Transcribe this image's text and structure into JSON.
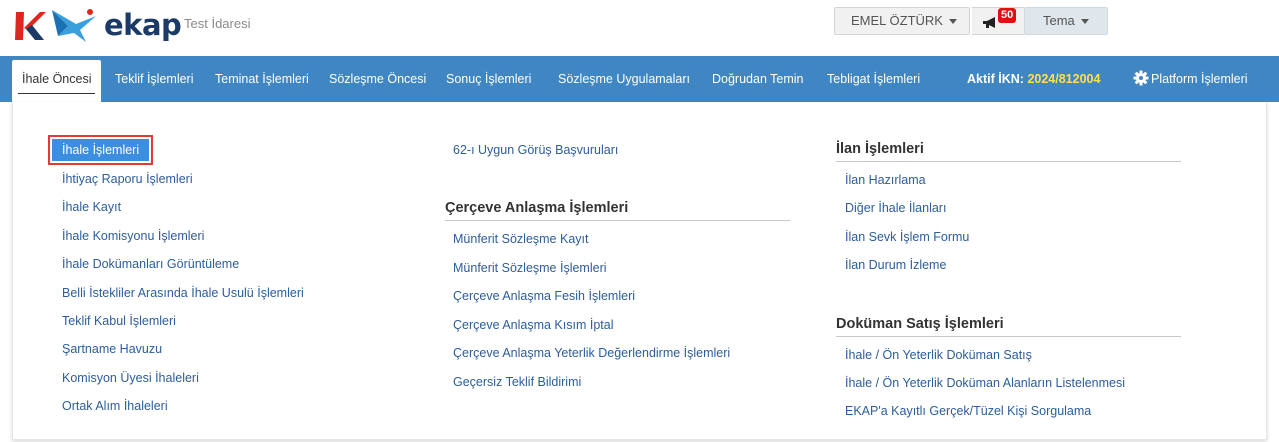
{
  "header": {
    "brand": "ekap",
    "org": "Test İdaresi",
    "user": "EMEL ÖZTÜRK",
    "notification_count": "50",
    "theme": "Tema",
    "colors": {
      "brand_red": "#e0261f",
      "brand_navy": "#1b3a66",
      "bird_blue": "#3aa0dc",
      "badge": "#e01010"
    }
  },
  "nav": {
    "items": [
      "İhale Öncesi",
      "Teklif İşlemleri",
      "Teminat İşlemleri",
      "Sözleşme Öncesi",
      "Sonuç İşlemleri",
      "Sözleşme Uygulamaları",
      "Doğrudan Temin",
      "Tebligat İşlemleri"
    ],
    "active_index": 0,
    "ikn_label": "Aktif İKN:",
    "ikn_value": "2024/812004",
    "platform": "Platform İşlemleri",
    "colors": {
      "bar": "#3f86c2",
      "ikn": "#ffe14a"
    }
  },
  "menu": {
    "col1": [
      "İhale İşlemleri",
      "İhtiyaç Raporu İşlemleri",
      "İhale Kayıt",
      "İhale Komisyonu İşlemleri",
      "İhale Dokümanları Görüntüleme",
      "Belli İstekliler Arasında İhale Usulü İşlemleri",
      "Teklif Kabul İşlemleri",
      "Şartname Havuzu",
      "Komisyon Üyesi İhaleleri",
      "Ortak Alım İhaleleri"
    ],
    "col1_selected_index": 0,
    "col2_top": "62-ı Uygun Görüş Başvuruları",
    "cerceve_title": "Çerçeve Anlaşma İşlemleri",
    "cerceve": [
      "Münferit Sözleşme Kayıt",
      "Münferit Sözleşme İşlemleri",
      "Çerçeve Anlaşma Fesih İşlemleri",
      "Çerçeve Anlaşma Kısım İptal",
      "Çerçeve Anlaşma Yeterlik Değerlendirme İşlemleri",
      "Geçersiz Teklif Bildirimi"
    ],
    "ilan_title": "İlan İşlemleri",
    "ilan": [
      "İlan Hazırlama",
      "Diğer İhale İlanları",
      "İlan Sevk İşlem Formu",
      "İlan Durum İzleme"
    ],
    "dokuman_title": "Doküman Satış İşlemleri",
    "dokuman": [
      "İhale / Ön Yeterlik Doküman Satış",
      "İhale / Ön Yeterlik Doküman Alanların Listelenmesi",
      "EKAP'a Kayıtlı Gerçek/Tüzel Kişi Sorgulama"
    ],
    "colors": {
      "link": "#2d5d9a",
      "selected_bg": "#3c8ee0",
      "selected_outline": "#e53935"
    }
  }
}
